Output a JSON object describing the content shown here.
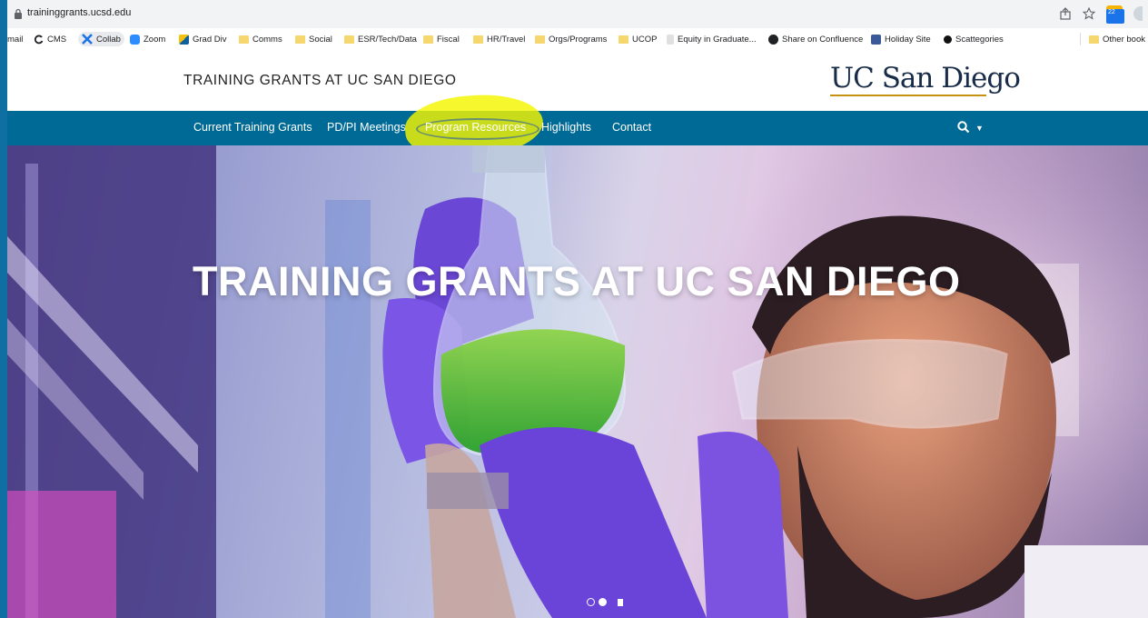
{
  "browser": {
    "url": "traininggrants.ucsd.edu",
    "bookmarks": [
      {
        "label": "mail",
        "icon": "none"
      },
      {
        "label": "CMS",
        "icon": "refresh-icon"
      },
      {
        "label": "Collab",
        "icon": "collab-icon"
      },
      {
        "label": "Zoom",
        "icon": "zoom-icon"
      },
      {
        "label": "Grad Div",
        "icon": "grad-div-icon"
      },
      {
        "label": "Comms",
        "icon": "folder-icon"
      },
      {
        "label": "Social",
        "icon": "folder-icon"
      },
      {
        "label": "ESR/Tech/Data",
        "icon": "folder-icon"
      },
      {
        "label": "Fiscal",
        "icon": "folder-icon"
      },
      {
        "label": "HR/Travel",
        "icon": "folder-icon"
      },
      {
        "label": "Orgs/Programs",
        "icon": "folder-icon"
      },
      {
        "label": "UCOP",
        "icon": "folder-icon"
      },
      {
        "label": "Equity in Graduate...",
        "icon": "page-icon"
      },
      {
        "label": "Share on Confluence",
        "icon": "globe-icon"
      },
      {
        "label": "Holiday Site",
        "icon": "calendar-icon"
      },
      {
        "label": "Scattegories",
        "icon": "circle-icon"
      },
      {
        "label": "Other book",
        "icon": "folder-icon"
      }
    ],
    "calendar_badge": "22"
  },
  "site": {
    "title": "TRAINING GRANTS AT UC SAN DIEGO",
    "logo": "UC San Diego"
  },
  "nav": {
    "items": [
      "Current Training Grants",
      "PD/PI Meetings",
      "Program Resources",
      "Highlights",
      "Contact"
    ],
    "highlighted": "Program Resources"
  },
  "hero": {
    "title": "TRAINING GRANTS AT UC SAN DIEGO"
  },
  "colors": {
    "nav_bg": "#006a96",
    "logo_navy": "#182b49",
    "logo_gold": "#c69214",
    "highlight_yellow": "#f5f500"
  }
}
